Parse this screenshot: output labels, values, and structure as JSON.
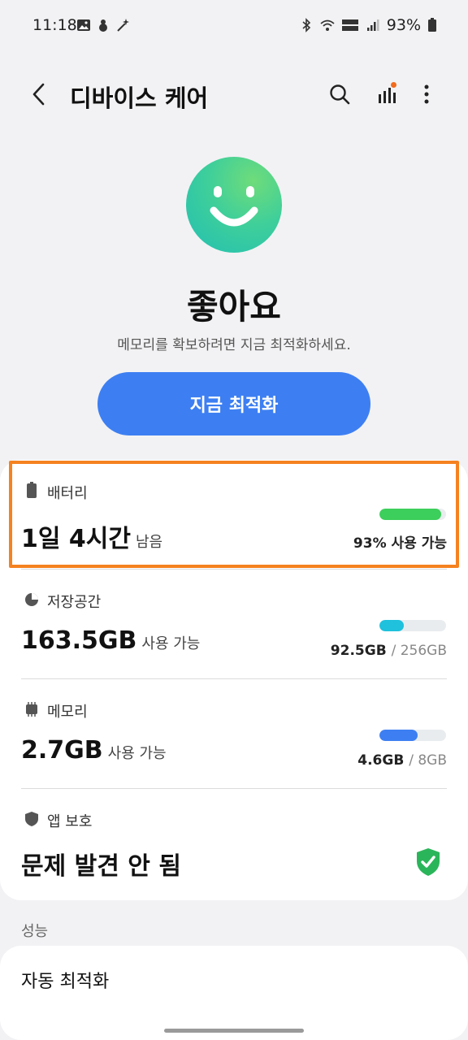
{
  "status_bar": {
    "time": "11:18",
    "battery_percent": "93%",
    "battery_level": 0.93
  },
  "app_bar": {
    "title": "디바이스 케어"
  },
  "summary": {
    "status_title": "좋아요",
    "message": "메모리를 확보하려면 지금 최적화하세요.",
    "optimize_button": "지금 최적화"
  },
  "battery": {
    "label": "배터리",
    "value": "1일 4시간",
    "suffix": "남음",
    "right_text": "93% 사용 가능",
    "level": 0.93,
    "color": "#3ccf5b"
  },
  "storage": {
    "label": "저장공간",
    "value": "163.5GB",
    "suffix": "사용 가능",
    "used": "92.5GB",
    "total": "/ 256GB",
    "level": 0.36,
    "color": "#1fc1dc"
  },
  "memory": {
    "label": "메모리",
    "value": "2.7GB",
    "suffix": "사용 가능",
    "used": "4.6GB",
    "total": "/ 8GB",
    "level": 0.57,
    "color": "#3d7ff2"
  },
  "app_protection": {
    "label": "앱 보호",
    "value": "문제 발견 안 됨",
    "status_color": "#2bb55a"
  },
  "performance": {
    "section_label": "성능",
    "auto_optimize": "자동 최적화"
  },
  "colors": {
    "accent": "#3d7ff2",
    "highlight": "#f58220"
  }
}
